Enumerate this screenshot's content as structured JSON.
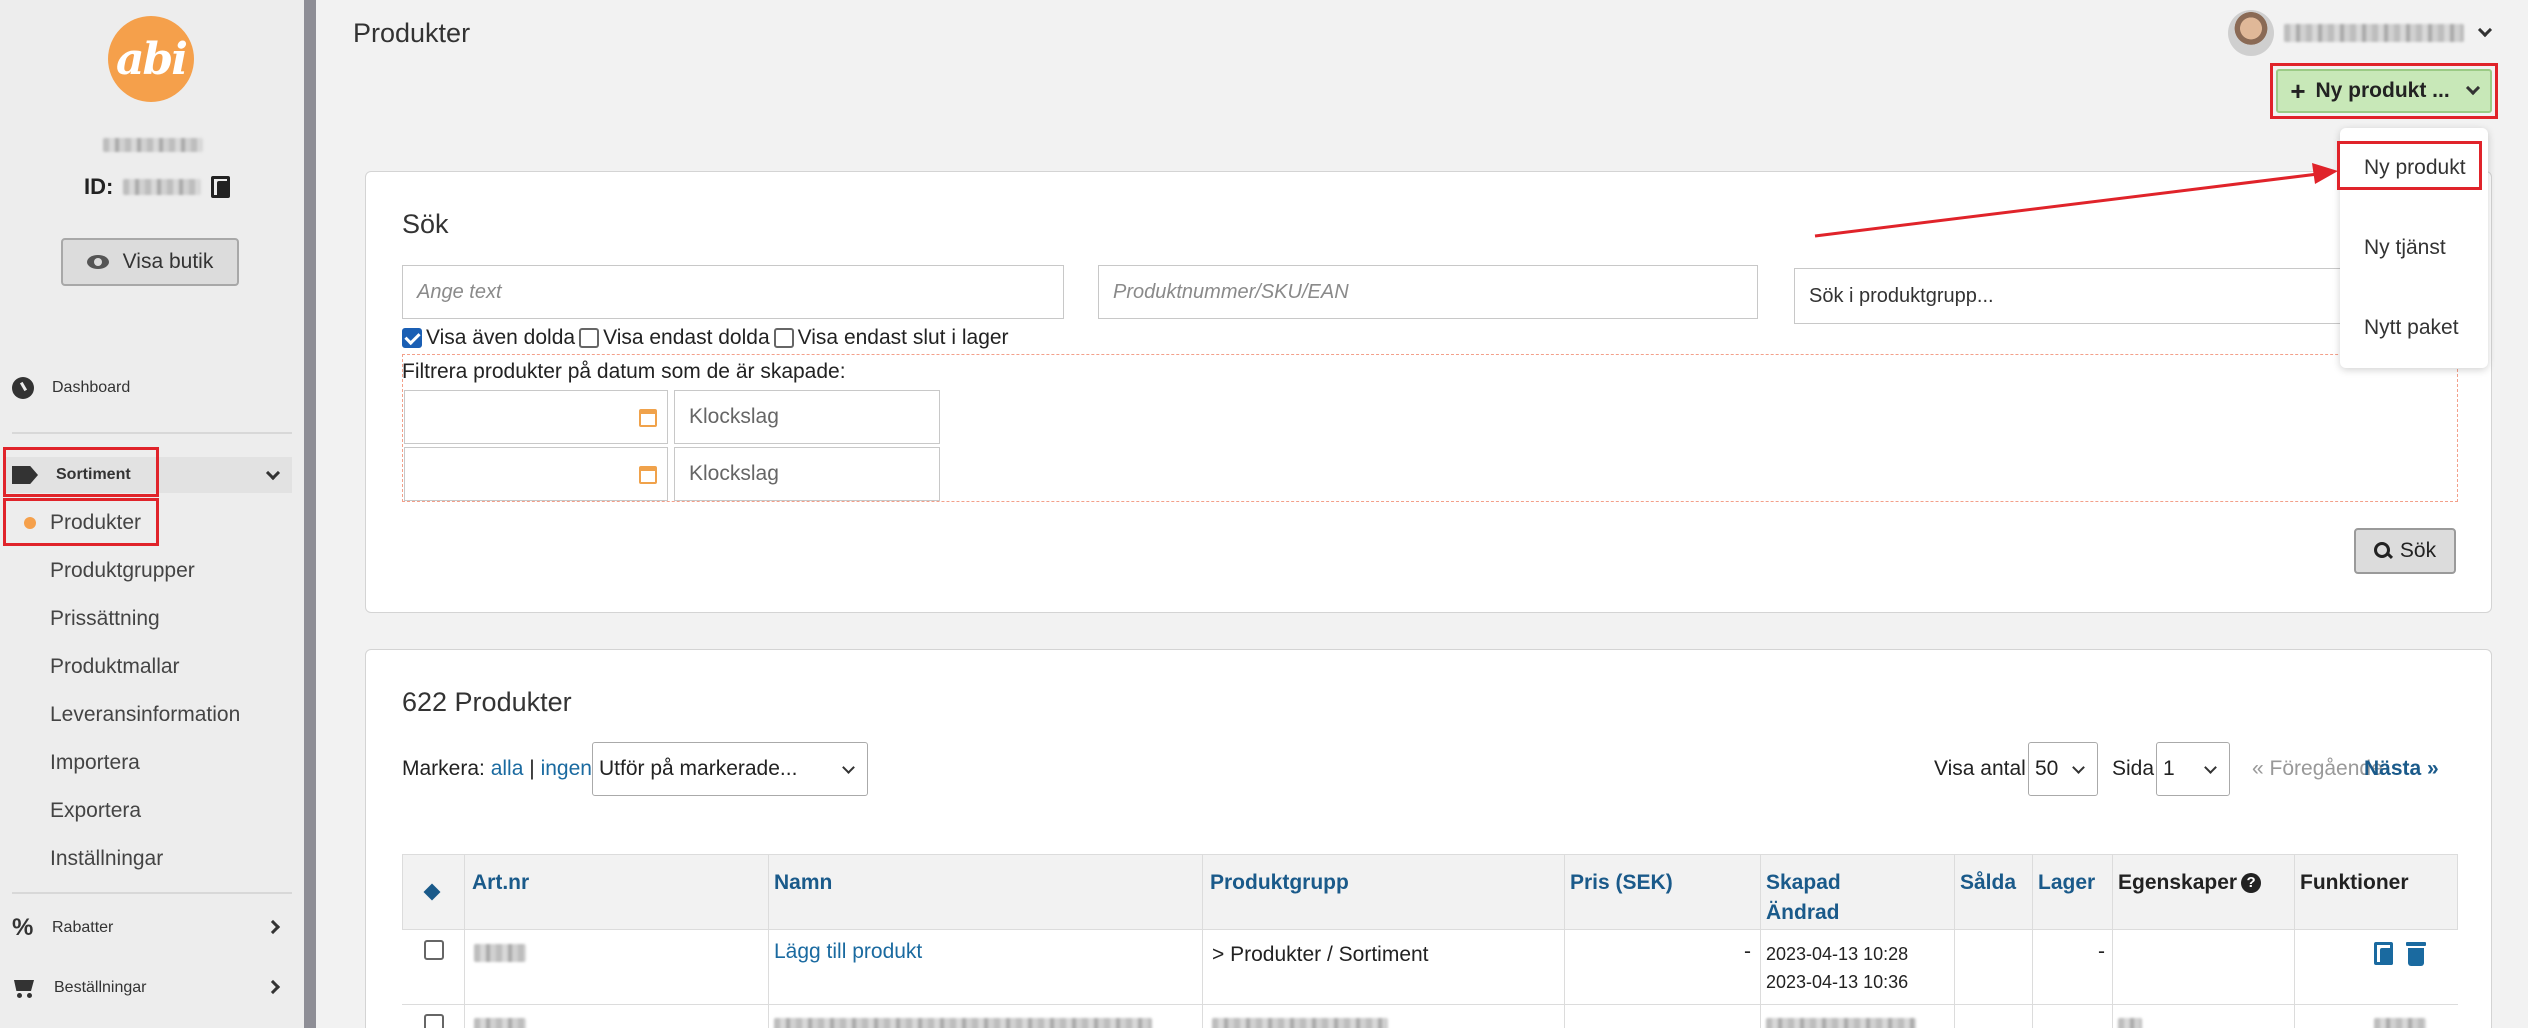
{
  "sidebar": {
    "logo_text": "abi",
    "id_label": "ID:",
    "visa_butik_label": "Visa butik",
    "nav": {
      "dashboard": "Dashboard",
      "sortiment": "Sortiment",
      "produkter": "Produkter",
      "produktgrupper": "Produktgrupper",
      "prissattning": "Prissättning",
      "produktmallar": "Produktmallar",
      "leveransinformation": "Leveransinformation",
      "importera": "Importera",
      "exportera": "Exportera",
      "installningar": "Inställningar",
      "rabatter": "Rabatter",
      "bestallningar": "Beställningar"
    },
    "accent_color": "#f5a04b"
  },
  "header": {
    "title": "Produkter",
    "new_button_label": "Ny produkt ...",
    "new_menu": [
      "Ny produkt",
      "Ny tjänst",
      "Nytt paket"
    ]
  },
  "search": {
    "title": "Sök",
    "text_placeholder": "Ange text",
    "sku_placeholder": "Produktnummer/SKU/EAN",
    "group_placeholder": "Sök i produktgrupp...",
    "show_hidden_label": "Visa även dolda",
    "show_hidden_checked": true,
    "only_hidden_label": "Visa endast dolda",
    "only_out_of_stock_label": "Visa endast slut i lager",
    "date_filter_label": "Filtrera produkter på datum som de är skapade:",
    "time_placeholder": "Klockslag",
    "search_button_label": "Sök"
  },
  "products": {
    "title": "622 Produkter",
    "mark_label": "Markera:",
    "mark_all": "alla",
    "mark_separator": "|",
    "mark_none": "ingen",
    "bulk_action": "Utför på markerade...",
    "show_count_label": "Visa antal",
    "show_count_value": "50",
    "page_label": "Sida",
    "page_value": "1",
    "prev_label": "« Föregående",
    "next_label": "Nästa »",
    "columns": {
      "artnr": "Art.nr",
      "namn": "Namn",
      "produktgrupp": "Produktgrupp",
      "pris": "Pris (SEK)",
      "skapad": "Skapad",
      "andrad": "Ändrad",
      "salda": "Sålda",
      "lager": "Lager",
      "egenskaper": "Egenskaper",
      "funktioner": "Funktioner"
    },
    "rows": [
      {
        "namn": "Lägg till produkt",
        "produktgrupp": ">  Produkter / Sortiment",
        "pris": "-",
        "skapad": "2023-04-13 10:28",
        "andrad": "2023-04-13 10:36",
        "lager": "-"
      }
    ]
  },
  "annotation_color": "#e0232a"
}
